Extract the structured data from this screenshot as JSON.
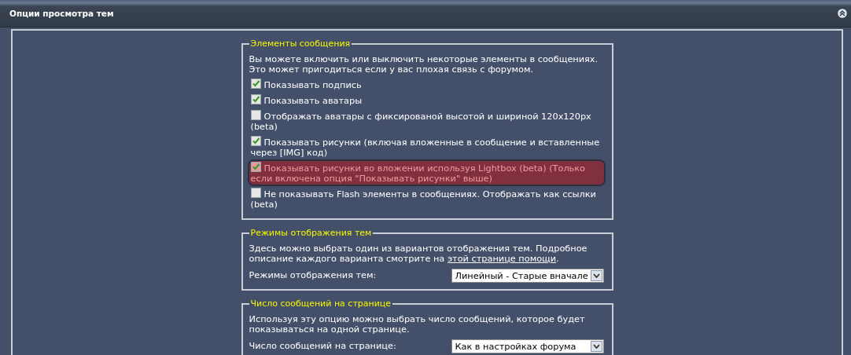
{
  "panel": {
    "title": "Опции просмотра тем",
    "collapsed": false
  },
  "sections": [
    {
      "kind": "checkboxes",
      "legend": "Элементы сообщения",
      "description": "Вы можете включить или выключить некоторые элементы в сообщениях. Это может пригодиться если у вас плохая связь с форумом.",
      "options": [
        {
          "label": "Показывать подпись",
          "checked": true,
          "highlighted": false
        },
        {
          "label": "Показывать аватары",
          "checked": true,
          "highlighted": false
        },
        {
          "label": "Отображать аватары с фиксированой высотой и шириной 120x120px (beta)",
          "checked": false,
          "highlighted": false
        },
        {
          "label": "Показывать рисунки (включая вложенные в сообщение и вставленные через [IMG] код)",
          "checked": true,
          "highlighted": false
        },
        {
          "label": "Показывать рисунки во вложении используя Lightbox (beta) (Только если включена опция \"Показывать рисунки\" выше)",
          "checked": true,
          "highlighted": true
        },
        {
          "label": "Не показывать Flash элементы в сообщениях. Отображать как ссылки (beta)",
          "checked": false,
          "highlighted": false
        }
      ]
    },
    {
      "kind": "select",
      "legend": "Режимы отображения тем",
      "description": "Здесь можно выбрать один из вариантов отображения тем. Подробное описание каждого варианта смотрите на",
      "link": "этой странице помощи",
      "after": ".",
      "field_label": "Режимы отображения тем:",
      "value": "Линейный - Старые вначале"
    },
    {
      "kind": "select",
      "legend": "Число сообщений на странице",
      "description": "Используя эту опцию можно выбрать число сообщений, которое будет показываться на одной странице.",
      "field_label": "Число сообщений на странице:",
      "value": "Как в настройках форума"
    }
  ]
}
